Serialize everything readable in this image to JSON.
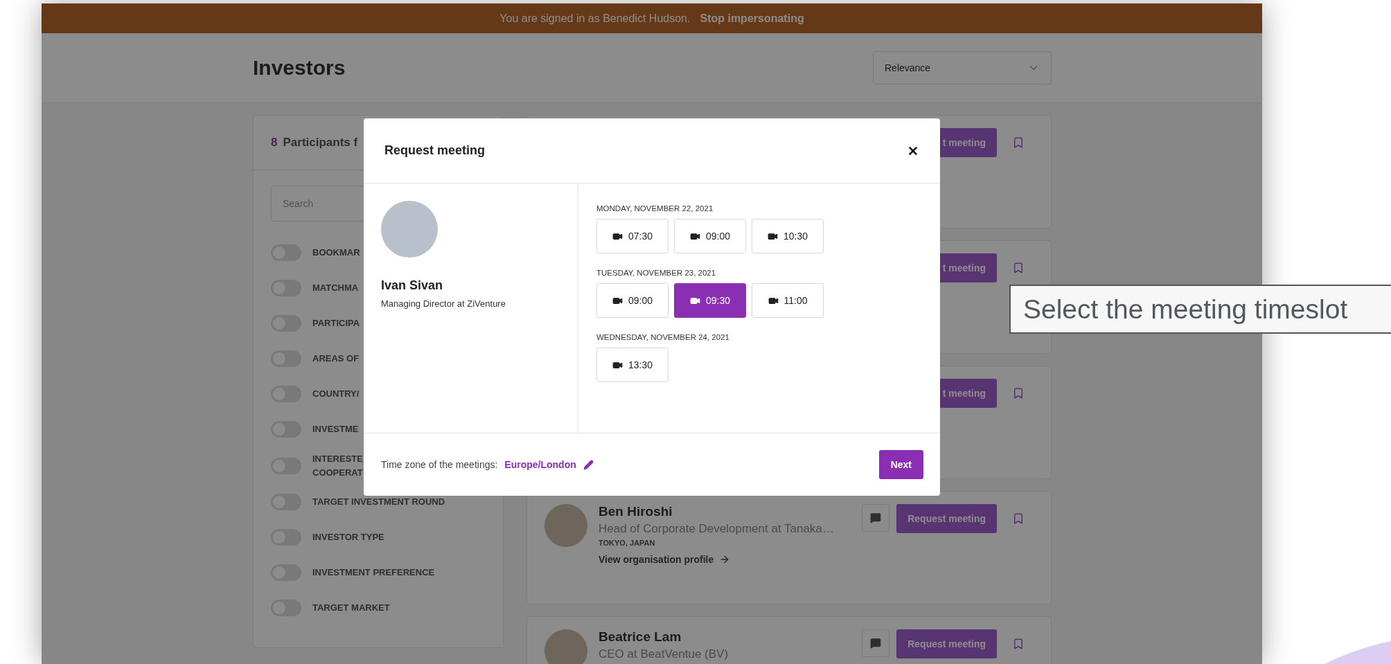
{
  "banner": {
    "text": "You are signed in as Benedict Hudson.",
    "link": "Stop impersonating"
  },
  "header": {
    "title": "Investors",
    "sort": {
      "value": "Relevance"
    }
  },
  "filters": {
    "count": "8",
    "title": "Participants f",
    "search": {
      "placeholder": "Search"
    },
    "toggles": [
      {
        "label": "BOOKMAR",
        "on": false
      },
      {
        "label": "MATCHMA",
        "on": false
      },
      {
        "label": "PARTICIPA",
        "on": false
      },
      {
        "label": "AREAS OF",
        "on": false
      },
      {
        "label": "COUNTRY/",
        "on": false
      },
      {
        "label": "INVESTME",
        "on": false
      },
      {
        "label": "INTERESTE\nCOOPERAT",
        "on": false
      },
      {
        "label": "TARGET INVESTMENT ROUND",
        "on": false
      },
      {
        "label": "INVESTOR TYPE",
        "on": false
      },
      {
        "label": "INVESTMENT PREFERENCE",
        "on": false
      },
      {
        "label": "TARGET MARKET",
        "on": false
      }
    ]
  },
  "cards": [
    {
      "kind": "covered",
      "button": "t meeting"
    },
    {
      "kind": "covered",
      "button": "t meeting"
    },
    {
      "kind": "covered",
      "button": "t meeting"
    },
    {
      "kind": "full",
      "name": "Ben Hiroshi",
      "title": "Head of Corporate Development at Tanaka…",
      "location": "TOKYO, JAPAN",
      "link": "View organisation profile",
      "button": "Request meeting"
    },
    {
      "kind": "full",
      "name": "Beatrice Lam",
      "title": "CEO at BeatVentue (BV)",
      "button": "Request meeting"
    }
  ],
  "modal": {
    "title": "Request meeting",
    "person": {
      "name": "Ivan Sivan",
      "role": "Managing Director at ZiVenture"
    },
    "days": [
      {
        "date": "MONDAY, NOVEMBER 22, 2021",
        "slots": [
          {
            "time": "07:30",
            "selected": false
          },
          {
            "time": "09:00",
            "selected": false
          },
          {
            "time": "10:30",
            "selected": false
          }
        ]
      },
      {
        "date": "TUESDAY, NOVEMBER 23, 2021",
        "slots": [
          {
            "time": "09:00",
            "selected": false
          },
          {
            "time": "09:30",
            "selected": true
          },
          {
            "time": "11:00",
            "selected": false
          }
        ]
      },
      {
        "date": "WEDNESDAY, NOVEMBER 24, 2021",
        "slots": [
          {
            "time": "13:30",
            "selected": false
          }
        ]
      }
    ],
    "timezone": {
      "label": "Time zone of the meetings:",
      "value": "Europe/London"
    },
    "next": "Next"
  },
  "annotation": {
    "text": "Select the meeting timeslot"
  }
}
